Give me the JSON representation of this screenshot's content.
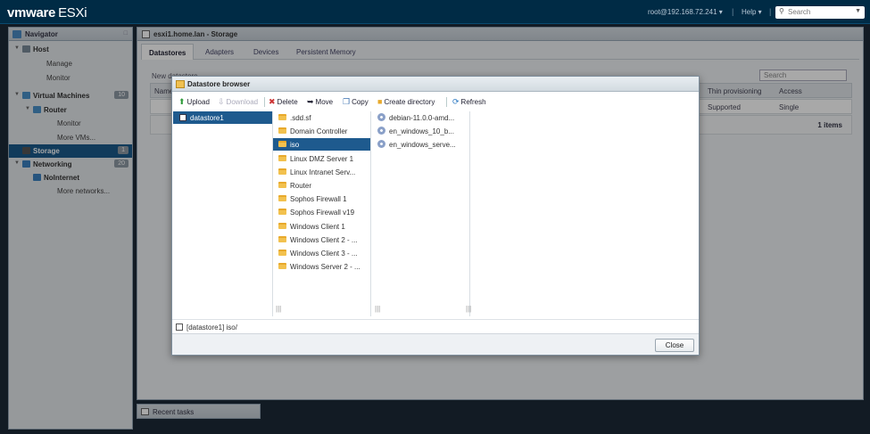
{
  "app": {
    "brand_vm": "vm",
    "brand_ware": "ware",
    "product": "ESXi",
    "user": "root@192.168.72.241 ▾",
    "separator": "|",
    "help": "Help ▾",
    "search_placeholder": "Search"
  },
  "navigator": {
    "title": "Navigator",
    "items": [
      {
        "label": "Host",
        "level": 0,
        "section": true,
        "expanded": true,
        "icon": "host-icon"
      },
      {
        "label": "Manage",
        "level": 1
      },
      {
        "label": "Monitor",
        "level": 1
      },
      {
        "label": "Virtual Machines",
        "level": 0,
        "section": true,
        "expanded": true,
        "badge": "10",
        "icon": "vm-icon"
      },
      {
        "label": "Router",
        "level": 1,
        "section": true,
        "expanded": true,
        "icon": "vm-icon"
      },
      {
        "label": "Monitor",
        "level": 2
      },
      {
        "label": "More VMs...",
        "level": 2
      },
      {
        "label": "Storage",
        "level": 0,
        "section": true,
        "active": true,
        "badge": "1",
        "icon": "storage-icon"
      },
      {
        "label": "Networking",
        "level": 0,
        "section": true,
        "expanded": true,
        "badge": "20",
        "icon": "network-icon"
      },
      {
        "label": "NoInternet",
        "level": 1,
        "section": true,
        "icon": "network-icon"
      },
      {
        "label": "More networks...",
        "level": 2
      }
    ]
  },
  "main": {
    "title": "esxi1.home.lan - Storage",
    "tabs": [
      "Datastores",
      "Adapters",
      "Devices",
      "Persistent Memory"
    ],
    "active_tab": 0,
    "search_placeholder": "Search",
    "toolbar_partial": "New datastore",
    "columns": {
      "name": "Name",
      "thin": "Thin provisioning",
      "access": "Access"
    },
    "row": {
      "thin": "Supported",
      "access": "Single"
    },
    "footer_count": "1 items"
  },
  "recent_tasks": "Recent tasks",
  "dialog": {
    "title": "Datastore browser",
    "toolbar": {
      "upload": "Upload",
      "download": "Download",
      "delete": "Delete",
      "move": "Move",
      "copy": "Copy",
      "create_directory": "Create directory",
      "refresh": "Refresh"
    },
    "col1": [
      {
        "label": "datastore1",
        "selected": true
      }
    ],
    "col2": [
      {
        "label": ".sdd.sf"
      },
      {
        "label": "Domain Controller"
      },
      {
        "label": "iso",
        "selected": true
      },
      {
        "label": "Linux DMZ Server 1"
      },
      {
        "label": "Linux Intranet Serv..."
      },
      {
        "label": "Router"
      },
      {
        "label": "Sophos Firewall 1"
      },
      {
        "label": "Sophos Firewall v19"
      },
      {
        "label": "Windows Client 1"
      },
      {
        "label": "Windows Client 2 - ..."
      },
      {
        "label": "Windows Client 3 - ..."
      },
      {
        "label": "Windows Server 2 - ..."
      }
    ],
    "col3": [
      {
        "label": "debian-11.0.0-amd..."
      },
      {
        "label": "en_windows_10_b..."
      },
      {
        "label": "en_windows_serve..."
      }
    ],
    "path": "[datastore1] iso/",
    "close_label": "Close"
  },
  "colors": {
    "topbar": "#002b45",
    "selection": "#1e5a8e",
    "folder": "#f2c14e"
  }
}
